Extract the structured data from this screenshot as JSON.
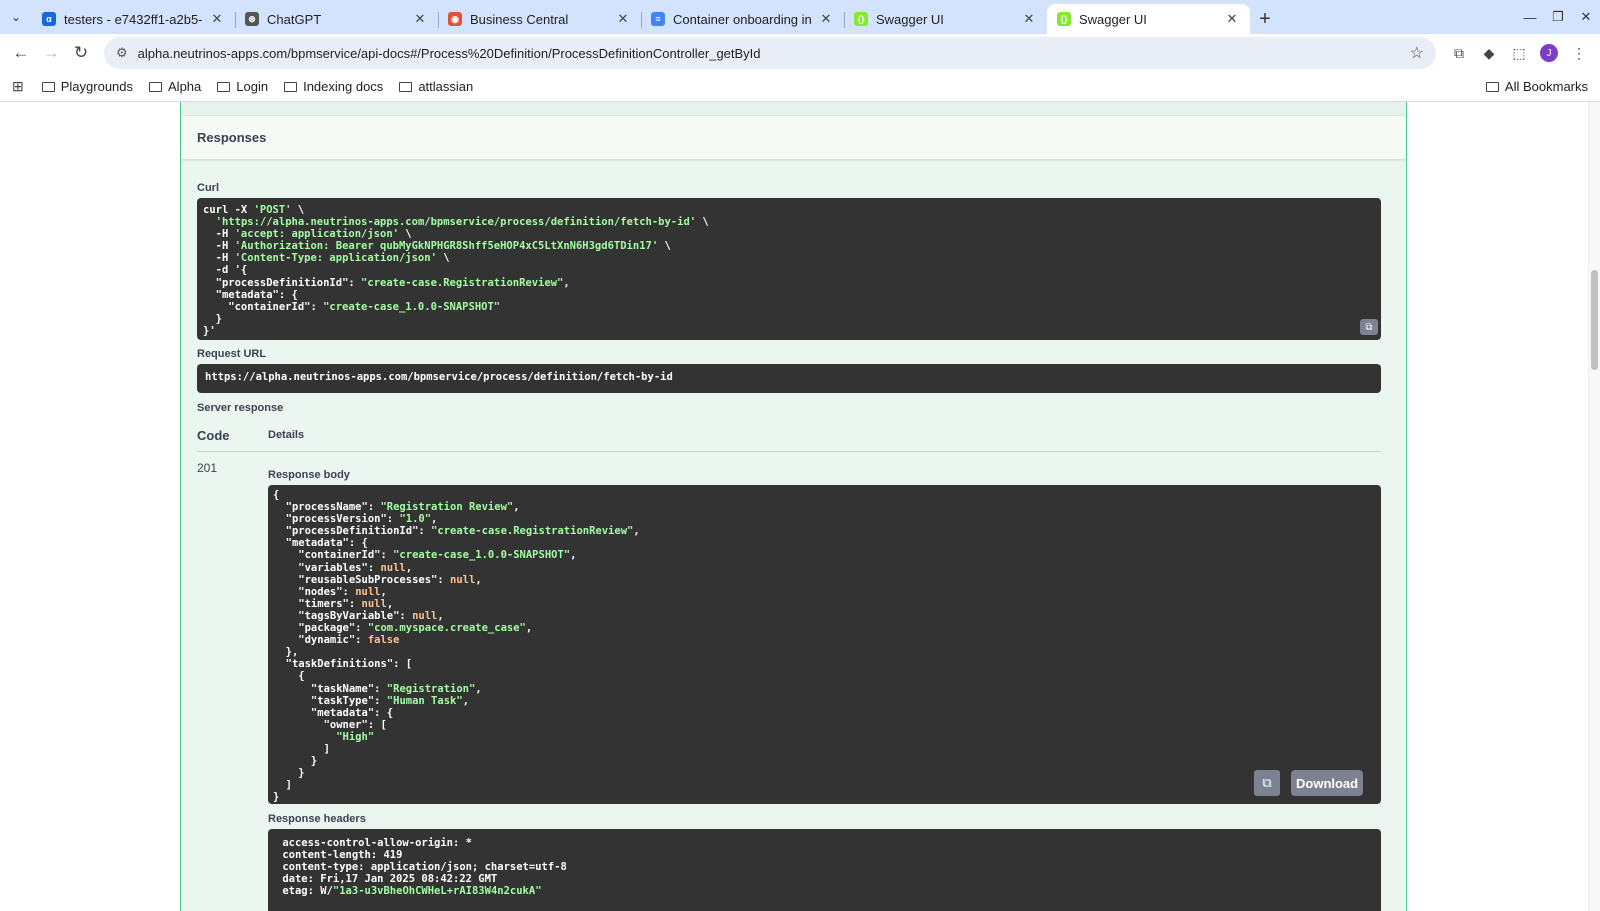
{
  "browser": {
    "tabs": [
      {
        "title": "testers - e7432ff1-a2b5-",
        "favicon_color": "#1868db",
        "favicon_glyph": "α"
      },
      {
        "title": "ChatGPT",
        "favicon_color": "#555555",
        "favicon_glyph": "⊛"
      },
      {
        "title": "Business Central",
        "favicon_color": "#e0553a",
        "favicon_glyph": "◉"
      },
      {
        "title": "Container onboarding in",
        "favicon_color": "#4285f4",
        "favicon_glyph": "≡"
      },
      {
        "title": "Swagger UI",
        "favicon_color": "#85ea2d",
        "favicon_glyph": "{}"
      },
      {
        "title": "Swagger UI",
        "favicon_color": "#85ea2d",
        "favicon_glyph": "{}"
      }
    ],
    "active_tab_index": 5,
    "url": "alpha.neutrinos-apps.com/bpmservice/api-docs#/Process%20Definition/ProcessDefinitionController_getById",
    "profile_initial": "J",
    "bookmarks": [
      "Playgrounds",
      "Alpha",
      "Login",
      "Indexing docs",
      "attlassian"
    ],
    "all_bookmarks": "All Bookmarks"
  },
  "page": {
    "responses_title": "Responses",
    "curl_label": "Curl",
    "curl_lines": [
      "curl -X 'POST' \\",
      "  'https://alpha.neutrinos-apps.com/bpmservice/process/definition/fetch-by-id' \\",
      "  -H 'accept: application/json' \\",
      "  -H 'Authorization: Bearer qubMyGkNPHGR8Shff5eHOP4xC5LtXnN6H3gd6TDin17' \\",
      "  -H 'Content-Type: application/json' \\",
      "  -d '{",
      "  \"processDefinitionId\": \"create-case.RegistrationReview\",",
      "  \"metadata\": {",
      "    \"containerId\": \"create-case_1.0.0-SNAPSHOT\"",
      "  }",
      "}'"
    ],
    "request_url_label": "Request URL",
    "request_url": "https://alpha.neutrinos-apps.com/bpmservice/process/definition/fetch-by-id",
    "server_response_label": "Server response",
    "code_header": "Code",
    "details_header": "Details",
    "status_code": "201",
    "response_body_label": "Response body",
    "response_body_lines": [
      "{",
      "  \"processName\": \"Registration Review\",",
      "  \"processVersion\": \"1.0\",",
      "  \"processDefinitionId\": \"create-case.RegistrationReview\",",
      "  \"metadata\": {",
      "    \"containerId\": \"create-case_1.0.0-SNAPSHOT\",",
      "    \"variables\": null,",
      "    \"reusableSubProcesses\": null,",
      "    \"nodes\": null,",
      "    \"timers\": null,",
      "    \"tagsByVariable\": null,",
      "    \"package\": \"com.myspace.create_case\",",
      "    \"dynamic\": false",
      "  },",
      "  \"taskDefinitions\": [",
      "    {",
      "      \"taskName\": \"Registration\",",
      "      \"taskType\": \"Human Task\",",
      "      \"metadata\": {",
      "        \"owner\": [",
      "          \"High\"",
      "        ]",
      "      }",
      "    }",
      "  ]",
      "}"
    ],
    "download_label": "Download",
    "response_headers_label": "Response headers",
    "response_headers_lines": [
      " access-control-allow-origin: *",
      " content-length: 419",
      " content-type: application/json; charset=utf-8",
      " date: Fri,17 Jan 2025 08:42:22 GMT",
      " etag: W/\"1a3-u3vBheOhCWHeL+rAI83W4n2cukA\""
    ]
  }
}
